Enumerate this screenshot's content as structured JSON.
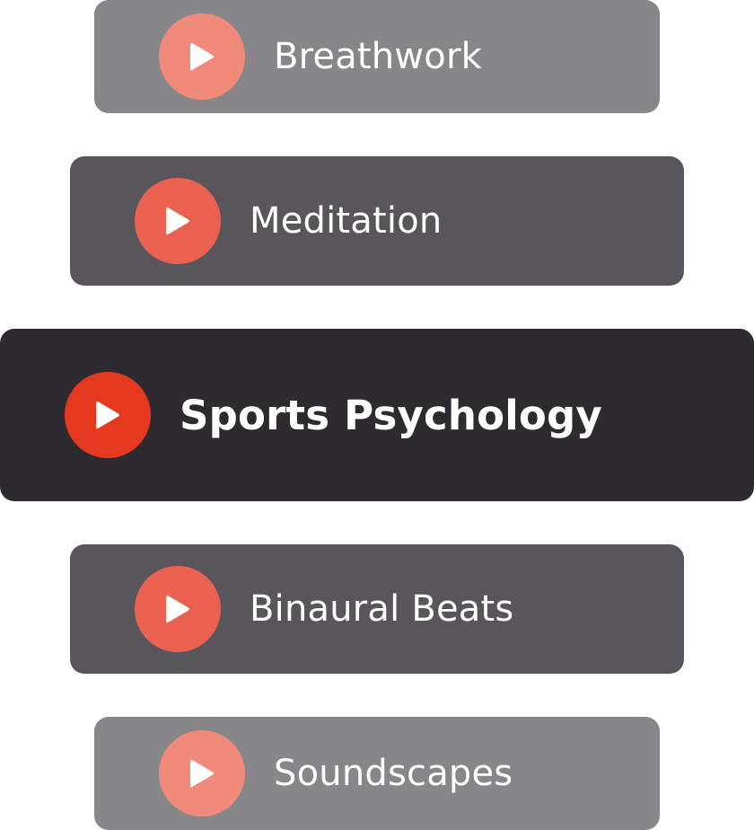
{
  "playlist": {
    "items": [
      {
        "label": "Breathwork",
        "icon": "play-icon"
      },
      {
        "label": "Meditation",
        "icon": "play-icon"
      },
      {
        "label": "Sports Psychology",
        "icon": "play-icon",
        "active": true
      },
      {
        "label": "Binaural Beats",
        "icon": "play-icon"
      },
      {
        "label": "Soundscapes",
        "icon": "play-icon"
      }
    ]
  },
  "colors": {
    "outer_card": "#87878a",
    "middle_card": "#58565b",
    "active_card": "#2d2b30",
    "outer_play": "#f08a7a",
    "middle_play": "#ea6150",
    "active_play": "#e5391f",
    "text": "#ffffff"
  }
}
